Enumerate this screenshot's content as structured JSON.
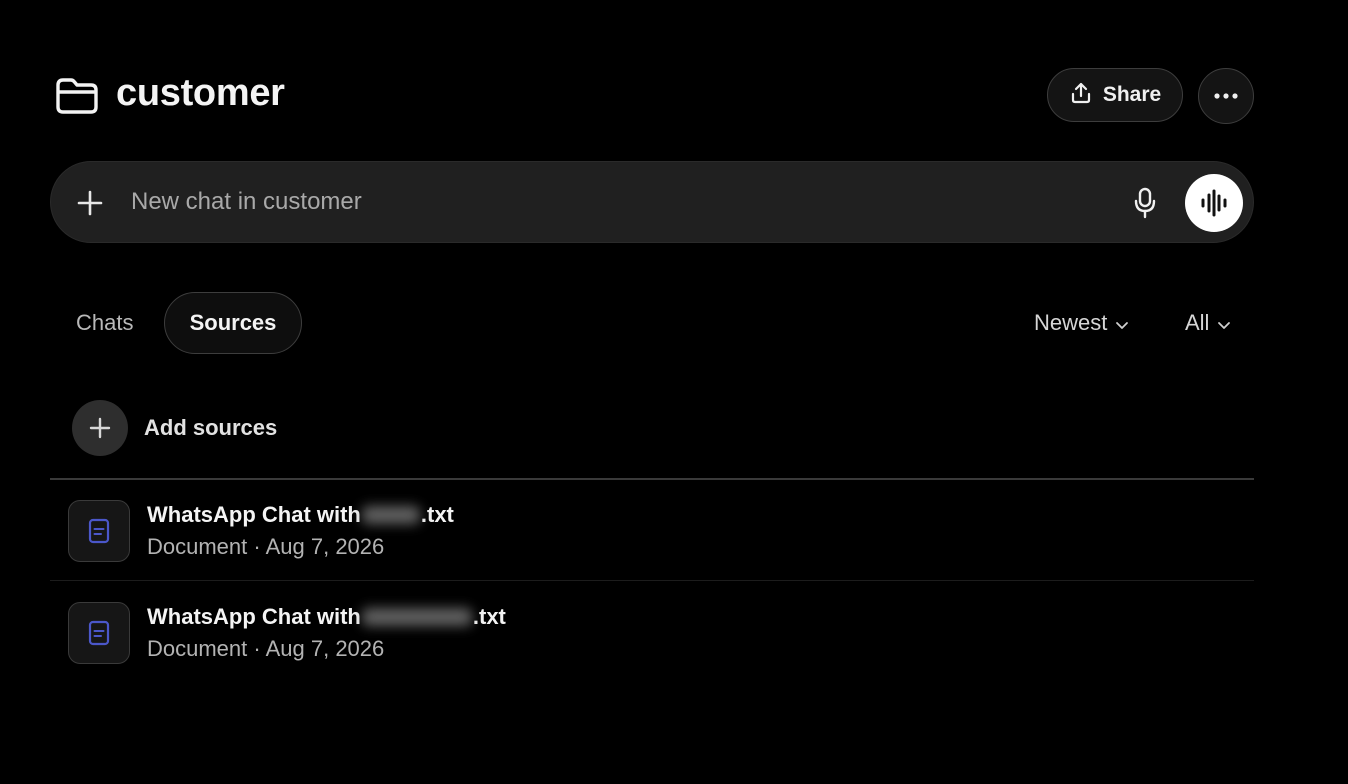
{
  "header": {
    "title": "customer",
    "folder_icon": "folder-icon",
    "share_label": "Share",
    "share_icon": "upload-icon",
    "more_icon": "more-horizontal-icon"
  },
  "composer": {
    "placeholder": "New chat in customer",
    "value": "",
    "plus_icon": "plus-icon",
    "mic_icon": "microphone-icon",
    "voice_icon": "voice-waveform-icon"
  },
  "tabs": [
    {
      "label": "Chats",
      "active": false
    },
    {
      "label": "Sources",
      "active": true
    }
  ],
  "filters": {
    "sort_label": "Newest",
    "type_label": "All"
  },
  "add_sources": {
    "label": "Add sources",
    "icon": "plus-icon"
  },
  "sources": [
    {
      "title_prefix": "WhatsApp Chat with",
      "title_suffix": ".txt",
      "name_redacted": true,
      "meta": "Document · Aug 7, 2026",
      "icon": "document-icon"
    },
    {
      "title_prefix": "WhatsApp Chat with",
      "title_suffix": ".txt",
      "name_redacted": true,
      "meta": "Document · Aug 7, 2026",
      "icon": "document-icon"
    }
  ],
  "colors": {
    "background": "#000000",
    "composer_bg": "#202020",
    "doc_icon_accent": "#4b57c9",
    "text_primary": "#f4f4f4",
    "text_secondary": "#b3b3b3"
  }
}
